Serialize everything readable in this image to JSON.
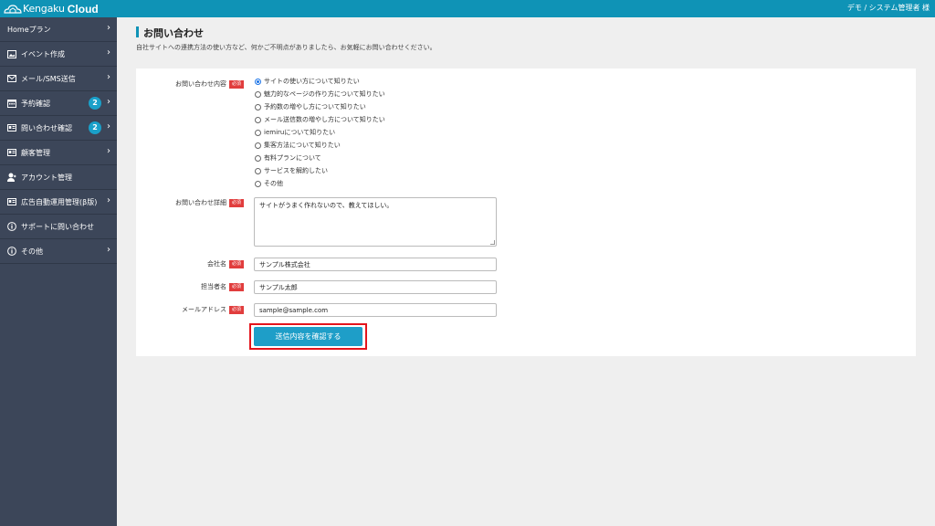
{
  "header": {
    "brand_name": "Kengaku",
    "brand_suffix": "Cloud",
    "user_label": "デモ / システム管理者 様"
  },
  "sidebar": {
    "items": [
      {
        "label": "Homeプラン",
        "icon": "none",
        "chevron": "›"
      },
      {
        "label": "イベント作成",
        "icon": "image-icon",
        "chevron": "›"
      },
      {
        "label": "メール/SMS送信",
        "icon": "mail-icon",
        "chevron": "›"
      },
      {
        "label": "予約確認",
        "icon": "calendar-icon",
        "badge": "2",
        "chevron": "›"
      },
      {
        "label": "問い合わせ確認",
        "icon": "id-card-icon",
        "badge": "2",
        "chevron": "›"
      },
      {
        "label": "顧客管理",
        "icon": "id-card-icon",
        "chevron": "›"
      },
      {
        "label": "アカウント管理",
        "icon": "user-icon"
      },
      {
        "label": "広告自動運用管理(β版)",
        "icon": "id-card-icon",
        "chevron": "›"
      },
      {
        "label": "サポートに問い合わせ",
        "icon": "info-icon"
      },
      {
        "label": "その他",
        "icon": "info-icon",
        "chevron": "›"
      }
    ]
  },
  "main": {
    "title": "お問い合わせ",
    "description": "自社サイトへの連携方法の使い方など、何かご不明点がありましたら、お気軽にお問い合わせください。"
  },
  "form": {
    "required_badge": "必須",
    "inquiry_type": {
      "label": "お問い合わせ内容",
      "options": [
        "サイトの使い方について知りたい",
        "魅力的なページの作り方について知りたい",
        "予約数の増やし方について知りたい",
        "メール送信数の増やし方について知りたい",
        "iemiruについて知りたい",
        "集客方法について知りたい",
        "有料プランについて",
        "サービスを解約したい",
        "その他"
      ],
      "selected_index": 0
    },
    "detail": {
      "label": "お問い合わせ詳細",
      "value": "サイトがうまく作れないので、教えてほしい。"
    },
    "company": {
      "label": "会社名",
      "value": "サンプル株式会社"
    },
    "person": {
      "label": "担当者名",
      "value": "サンプル太郎"
    },
    "email": {
      "label": "メールアドレス",
      "value": "sample@sample.com"
    },
    "submit_label": "送信内容を確認する"
  },
  "colors": {
    "header": "#0f93b6",
    "sidebar": "#3c4659",
    "badge": "#1aa0c9",
    "required": "#e13d3d",
    "submit": "#1e9ec8",
    "highlight": "#e3141c"
  }
}
